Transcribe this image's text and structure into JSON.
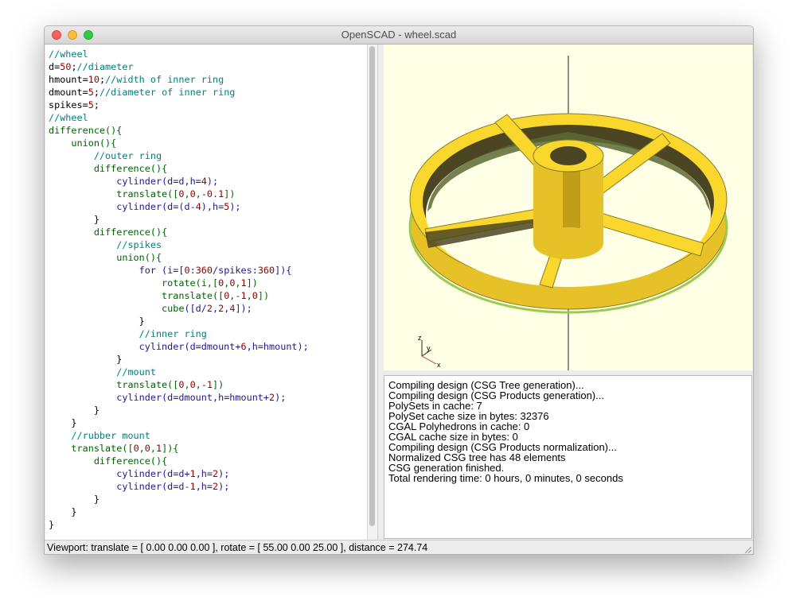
{
  "window": {
    "title": "OpenSCAD - wheel.scad"
  },
  "editor": {
    "lines": [
      [
        {
          "t": "//wheel",
          "c": "cm"
        }
      ],
      [
        {
          "t": "d",
          "c": "op"
        },
        {
          "t": "=",
          "c": "op"
        },
        {
          "t": "50",
          "c": "nm"
        },
        {
          "t": ";",
          "c": "op"
        },
        {
          "t": "//diameter",
          "c": "cm"
        }
      ],
      [
        {
          "t": "hmount",
          "c": "op"
        },
        {
          "t": "=",
          "c": "op"
        },
        {
          "t": "10",
          "c": "nm"
        },
        {
          "t": ";",
          "c": "op"
        },
        {
          "t": "//width of inner ring",
          "c": "cm"
        }
      ],
      [
        {
          "t": "dmount",
          "c": "op"
        },
        {
          "t": "=",
          "c": "op"
        },
        {
          "t": "5",
          "c": "nm"
        },
        {
          "t": ";",
          "c": "op"
        },
        {
          "t": "//diameter of inner ring",
          "c": "cm"
        }
      ],
      [
        {
          "t": "spikes",
          "c": "op"
        },
        {
          "t": "=",
          "c": "op"
        },
        {
          "t": "5",
          "c": "nm"
        },
        {
          "t": ";",
          "c": "op"
        }
      ],
      [
        {
          "t": "//wheel",
          "c": "cm"
        }
      ],
      [
        {
          "t": "difference",
          "c": "kw"
        },
        {
          "t": "(){",
          "c": "kw"
        }
      ],
      [
        {
          "t": "    ",
          "c": "op"
        },
        {
          "t": "union",
          "c": "kw"
        },
        {
          "t": "(){",
          "c": "kw"
        }
      ],
      [
        {
          "t": "        ",
          "c": "op"
        },
        {
          "t": "//outer ring",
          "c": "cm"
        }
      ],
      [
        {
          "t": "        ",
          "c": "op"
        },
        {
          "t": "difference",
          "c": "kw"
        },
        {
          "t": "(){",
          "c": "kw"
        }
      ],
      [
        {
          "t": "            ",
          "c": "op"
        },
        {
          "t": "cylinder",
          "c": "fn"
        },
        {
          "t": "(d=d,h=",
          "c": "fn"
        },
        {
          "t": "4",
          "c": "nm"
        },
        {
          "t": ");",
          "c": "fn"
        }
      ],
      [
        {
          "t": "            ",
          "c": "op"
        },
        {
          "t": "translate",
          "c": "kw"
        },
        {
          "t": "([",
          "c": "kw"
        },
        {
          "t": "0",
          "c": "nm"
        },
        {
          "t": ",",
          "c": "kw"
        },
        {
          "t": "0",
          "c": "nm"
        },
        {
          "t": ",",
          "c": "kw"
        },
        {
          "t": "-0.1",
          "c": "nm"
        },
        {
          "t": "])",
          "c": "kw"
        }
      ],
      [
        {
          "t": "            ",
          "c": "op"
        },
        {
          "t": "cylinder",
          "c": "fn"
        },
        {
          "t": "(d=(d-",
          "c": "fn"
        },
        {
          "t": "4",
          "c": "nm"
        },
        {
          "t": "),h=",
          "c": "fn"
        },
        {
          "t": "5",
          "c": "nm"
        },
        {
          "t": ");",
          "c": "fn"
        }
      ],
      [
        {
          "t": "        }",
          "c": "op"
        }
      ],
      [
        {
          "t": "        ",
          "c": "op"
        },
        {
          "t": "difference",
          "c": "kw"
        },
        {
          "t": "(){",
          "c": "kw"
        }
      ],
      [
        {
          "t": "            ",
          "c": "op"
        },
        {
          "t": "//spikes",
          "c": "cm"
        }
      ],
      [
        {
          "t": "            ",
          "c": "op"
        },
        {
          "t": "union",
          "c": "kw"
        },
        {
          "t": "(){",
          "c": "kw"
        }
      ],
      [
        {
          "t": "                ",
          "c": "op"
        },
        {
          "t": "for",
          "c": "fn"
        },
        {
          "t": " (i=[",
          "c": "fn"
        },
        {
          "t": "0",
          "c": "nm"
        },
        {
          "t": ":",
          "c": "fn"
        },
        {
          "t": "360",
          "c": "nm"
        },
        {
          "t": "/spikes:",
          "c": "fn"
        },
        {
          "t": "360",
          "c": "nm"
        },
        {
          "t": "]){",
          "c": "fn"
        }
      ],
      [
        {
          "t": "                    ",
          "c": "op"
        },
        {
          "t": "rotate",
          "c": "kw"
        },
        {
          "t": "(i,[",
          "c": "kw"
        },
        {
          "t": "0",
          "c": "nm"
        },
        {
          "t": ",",
          "c": "kw"
        },
        {
          "t": "0",
          "c": "nm"
        },
        {
          "t": ",",
          "c": "kw"
        },
        {
          "t": "1",
          "c": "nm"
        },
        {
          "t": "])",
          "c": "kw"
        }
      ],
      [
        {
          "t": "                    ",
          "c": "op"
        },
        {
          "t": "translate",
          "c": "kw"
        },
        {
          "t": "([",
          "c": "kw"
        },
        {
          "t": "0",
          "c": "nm"
        },
        {
          "t": ",",
          "c": "kw"
        },
        {
          "t": "-1",
          "c": "nm"
        },
        {
          "t": ",",
          "c": "kw"
        },
        {
          "t": "0",
          "c": "nm"
        },
        {
          "t": "])",
          "c": "kw"
        }
      ],
      [
        {
          "t": "                    ",
          "c": "op"
        },
        {
          "t": "cube",
          "c": "kw"
        },
        {
          "t": "([d/",
          "c": "fn"
        },
        {
          "t": "2",
          "c": "nm"
        },
        {
          "t": ",",
          "c": "fn"
        },
        {
          "t": "2",
          "c": "nm"
        },
        {
          "t": ",",
          "c": "fn"
        },
        {
          "t": "4",
          "c": "nm"
        },
        {
          "t": "]);",
          "c": "fn"
        }
      ],
      [
        {
          "t": "                }",
          "c": "op"
        }
      ],
      [
        {
          "t": "                ",
          "c": "op"
        },
        {
          "t": "//inner ring",
          "c": "cm"
        }
      ],
      [
        {
          "t": "                ",
          "c": "op"
        },
        {
          "t": "cylinder",
          "c": "fn"
        },
        {
          "t": "(d=dmount+",
          "c": "fn"
        },
        {
          "t": "6",
          "c": "nm"
        },
        {
          "t": ",h=hmount);",
          "c": "fn"
        }
      ],
      [
        {
          "t": "            }",
          "c": "op"
        }
      ],
      [
        {
          "t": "            ",
          "c": "op"
        },
        {
          "t": "//mount",
          "c": "cm"
        }
      ],
      [
        {
          "t": "            ",
          "c": "op"
        },
        {
          "t": "translate",
          "c": "kw"
        },
        {
          "t": "([",
          "c": "kw"
        },
        {
          "t": "0",
          "c": "nm"
        },
        {
          "t": ",",
          "c": "kw"
        },
        {
          "t": "0",
          "c": "nm"
        },
        {
          "t": ",",
          "c": "kw"
        },
        {
          "t": "-1",
          "c": "nm"
        },
        {
          "t": "])",
          "c": "kw"
        }
      ],
      [
        {
          "t": "            ",
          "c": "op"
        },
        {
          "t": "cylinder",
          "c": "fn"
        },
        {
          "t": "(d=dmount,h=hmount+",
          "c": "fn"
        },
        {
          "t": "2",
          "c": "nm"
        },
        {
          "t": ");",
          "c": "fn"
        }
      ],
      [
        {
          "t": "        }",
          "c": "op"
        }
      ],
      [
        {
          "t": "    }",
          "c": "op"
        }
      ],
      [
        {
          "t": "    ",
          "c": "op"
        },
        {
          "t": "//rubber mount",
          "c": "cm"
        }
      ],
      [
        {
          "t": "    ",
          "c": "op"
        },
        {
          "t": "translate",
          "c": "kw"
        },
        {
          "t": "([",
          "c": "kw"
        },
        {
          "t": "0",
          "c": "nm"
        },
        {
          "t": ",",
          "c": "kw"
        },
        {
          "t": "0",
          "c": "nm"
        },
        {
          "t": ",",
          "c": "kw"
        },
        {
          "t": "1",
          "c": "nm"
        },
        {
          "t": "]){",
          "c": "kw"
        }
      ],
      [
        {
          "t": "        ",
          "c": "op"
        },
        {
          "t": "difference",
          "c": "kw"
        },
        {
          "t": "(){",
          "c": "kw"
        }
      ],
      [
        {
          "t": "            ",
          "c": "op"
        },
        {
          "t": "cylinder",
          "c": "fn"
        },
        {
          "t": "(d=d+",
          "c": "fn"
        },
        {
          "t": "1",
          "c": "nm"
        },
        {
          "t": ",h=",
          "c": "fn"
        },
        {
          "t": "2",
          "c": "nm"
        },
        {
          "t": ");",
          "c": "fn"
        }
      ],
      [
        {
          "t": "            ",
          "c": "op"
        },
        {
          "t": "cylinder",
          "c": "fn"
        },
        {
          "t": "(d=d-",
          "c": "fn"
        },
        {
          "t": "1",
          "c": "nm"
        },
        {
          "t": ",h=",
          "c": "fn"
        },
        {
          "t": "2",
          "c": "nm"
        },
        {
          "t": ");",
          "c": "fn"
        }
      ],
      [
        {
          "t": "        }",
          "c": "op"
        }
      ],
      [
        {
          "t": "    }",
          "c": "op"
        }
      ],
      [
        {
          "t": "}",
          "c": "op"
        }
      ]
    ]
  },
  "viewport": {
    "axes_labels": {
      "z": "z",
      "y": "y",
      "x": "x"
    },
    "colors": {
      "background": "#ffffe5",
      "model": "#f9d72c",
      "model_dark": "#4b4523",
      "rubber": "#9dcb51"
    }
  },
  "console": {
    "lines": [
      "Compiling design (CSG Tree generation)...",
      "Compiling design (CSG Products generation)...",
      "PolySets in cache: 7",
      "PolySet cache size in bytes: 32376",
      "CGAL Polyhedrons in cache: 0",
      "CGAL cache size in bytes: 0",
      "Compiling design (CSG Products normalization)...",
      "Normalized CSG tree has 48 elements",
      "CSG generation finished.",
      "Total rendering time: 0 hours, 0 minutes, 0 seconds"
    ]
  },
  "status": {
    "text": "Viewport: translate = [ 0.00 0.00 0.00 ], rotate = [ 55.00 0.00 25.00 ], distance = 274.74"
  }
}
